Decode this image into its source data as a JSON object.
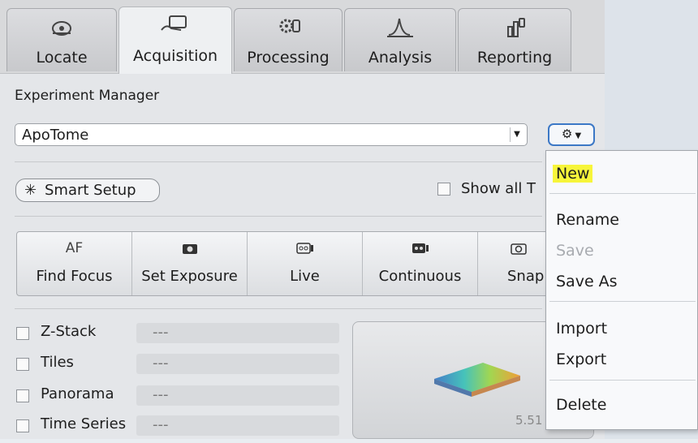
{
  "tabs": [
    {
      "label": "Locate",
      "icon": "locate-icon"
    },
    {
      "label": "Acquisition",
      "icon": "acquisition-icon"
    },
    {
      "label": "Processing",
      "icon": "processing-icon"
    },
    {
      "label": "Analysis",
      "icon": "analysis-icon"
    },
    {
      "label": "Reporting",
      "icon": "reporting-icon"
    }
  ],
  "experiment_manager": {
    "title": "Experiment Manager",
    "selected": "ApoTome"
  },
  "smart_setup": {
    "label": "Smart Setup"
  },
  "show_all": {
    "label": "Show all T"
  },
  "tools": [
    {
      "icon_text": "AF",
      "label": "Find Focus"
    },
    {
      "icon_text": "",
      "label": "Set Exposure"
    },
    {
      "icon_text": "",
      "label": "Live"
    },
    {
      "icon_text": "",
      "label": "Continuous"
    },
    {
      "icon_text": "",
      "label": "Snap"
    }
  ],
  "options": [
    {
      "label": "Z-Stack",
      "value": "---"
    },
    {
      "label": "Tiles",
      "value": "---"
    },
    {
      "label": "Panorama",
      "value": "---"
    },
    {
      "label": "Time Series",
      "value": "---"
    }
  ],
  "preview_value": "5.51",
  "menu": {
    "items": [
      {
        "label": "New",
        "highlighted": true,
        "enabled": true
      },
      {
        "label": "Rename",
        "enabled": true
      },
      {
        "label": "Save",
        "enabled": false
      },
      {
        "label": "Save As",
        "enabled": true
      },
      {
        "label": "Import",
        "enabled": true
      },
      {
        "label": "Export",
        "enabled": true
      },
      {
        "label": "Delete",
        "enabled": true
      }
    ]
  },
  "colors": {
    "highlight": "#f7f53a",
    "accent_border": "#3c78c6"
  }
}
